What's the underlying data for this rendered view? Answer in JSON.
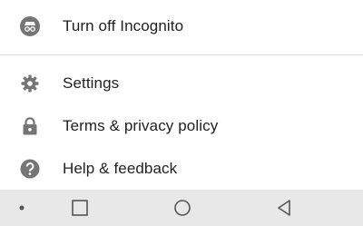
{
  "menu": {
    "items": [
      {
        "label": "Turn off Incognito",
        "icon": "incognito-icon"
      },
      {
        "label": "Settings",
        "icon": "gear-icon"
      },
      {
        "label": "Terms & privacy policy",
        "icon": "lock-icon"
      },
      {
        "label": "Help & feedback",
        "icon": "help-icon"
      }
    ]
  },
  "colors": {
    "icon": "#757575",
    "text": "#212121",
    "divider": "#dcdcdc",
    "navbar_bg": "#e8e8e8",
    "navbar_icon": "#555555"
  },
  "navbar": {
    "buttons": [
      "dot-icon",
      "recents-square-icon",
      "home-circle-icon",
      "back-triangle-icon"
    ]
  }
}
